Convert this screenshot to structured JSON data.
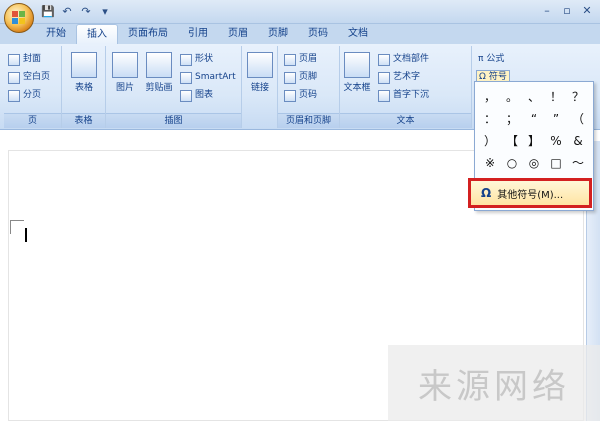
{
  "qat": {
    "save": "💾",
    "undo": "↶",
    "redo": "↷",
    "more": "▾"
  },
  "window": {
    "minimize": "–",
    "restore": "▫",
    "close": "✕"
  },
  "tabs": [
    "开始",
    "插入",
    "页面布局",
    "引用",
    "页眉",
    "页脚",
    "页码",
    "文档"
  ],
  "ribbon": {
    "pages": {
      "label": "页",
      "items": [
        "封面",
        "空白页",
        "分页"
      ]
    },
    "tables": {
      "label": "表格",
      "button": "表格"
    },
    "illustrations": {
      "label": "插图",
      "items": [
        "图片",
        "剪贴画",
        "形状",
        "SmartArt",
        "图表"
      ]
    },
    "links": {
      "label": "链接"
    },
    "header_footer": {
      "label": "页眉和页脚",
      "items": [
        "页眉",
        "页脚",
        "页码"
      ]
    },
    "text": {
      "label": "文本",
      "items": [
        "文本框",
        "文档部件",
        "艺术字",
        "首字下沉"
      ]
    },
    "symbols": {
      "formula": "公式",
      "symbol": "符号"
    }
  },
  "symbol_grid": [
    "，",
    "。",
    "、",
    "！",
    "？",
    "：",
    "；",
    "“",
    "”",
    "（",
    "）",
    "【",
    "】",
    "%",
    "&",
    "※",
    "○",
    "◎",
    "□",
    "～"
  ],
  "more_symbols": {
    "icon": "Ω",
    "label": "其他符号(M)..."
  },
  "watermark": "来源网络"
}
